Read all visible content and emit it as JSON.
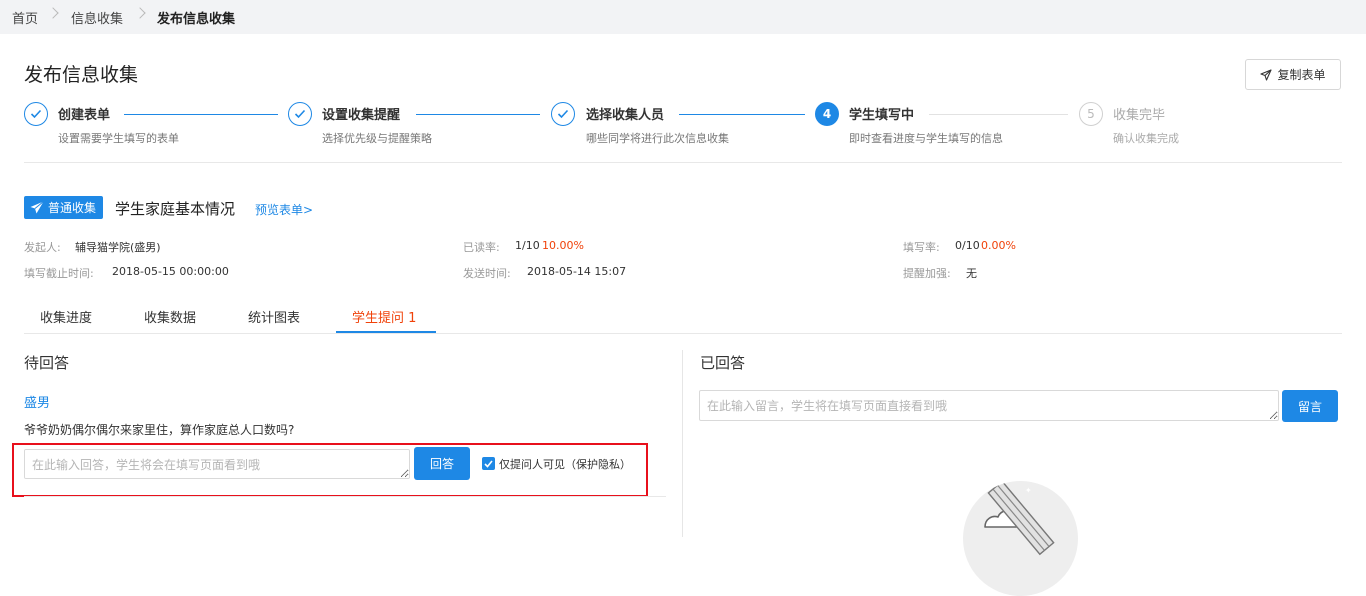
{
  "breadcrumb": [
    "首页",
    "信息收集",
    "发布信息收集"
  ],
  "page_title": "发布信息收集",
  "copy_button": "复制表单",
  "steps": [
    {
      "index": "1",
      "title": "创建表单",
      "desc": "设置需要学生填写的表单",
      "status": "done"
    },
    {
      "index": "2",
      "title": "设置收集提醒",
      "desc": "选择优先级与提醒策略",
      "status": "done"
    },
    {
      "index": "3",
      "title": "选择收集人员",
      "desc": "哪些同学将进行此次信息收集",
      "status": "done"
    },
    {
      "index": "4",
      "title": "学生填写中",
      "desc": "即时查看进度与学生填写的信息",
      "status": "active"
    },
    {
      "index": "5",
      "title": "收集完毕",
      "desc": "确认收集完成",
      "status": "pending"
    }
  ],
  "form": {
    "badge": "普通收集",
    "name": "学生家庭基本情况",
    "preview_link": "预览表单>"
  },
  "meta": {
    "initiator_label": "发起人:",
    "initiator": "辅导猫学院(盛男)",
    "deadline_label": "填写截止时间:",
    "deadline": "2018-05-15 00:00:00",
    "read_rate_label": "已读率:",
    "read_rate_count": "1/10",
    "read_rate_pct": "10.00%",
    "send_time_label": "发送时间:",
    "send_time": "2018-05-14 15:07",
    "fill_rate_label": "填写率:",
    "fill_rate_count": "0/10",
    "fill_rate_pct": "0.00%",
    "reminder_label": "提醒加强:",
    "reminder": "无"
  },
  "tabs": [
    "收集进度",
    "收集数据",
    "统计图表",
    "学生提问 1"
  ],
  "active_tab": 3,
  "pending": {
    "heading": "待回答",
    "asker": "盛男",
    "question": "爷爷奶奶偶尔偶尔来家里住，算作家庭总人口数吗?",
    "reply_placeholder": "在此输入回答，学生将会在填写页面看到哦",
    "reply_button": "回答",
    "private_label": "仅提问人可见（保护隐私）",
    "private_checked": true
  },
  "answered": {
    "heading": "已回答",
    "message_placeholder": "在此输入留言，学生将在填写页面直接看到哦",
    "message_button": "留言"
  },
  "colors": {
    "primary": "#1e88e5",
    "accent_red": "#f0420a",
    "highlight_box": "#e8101c"
  }
}
